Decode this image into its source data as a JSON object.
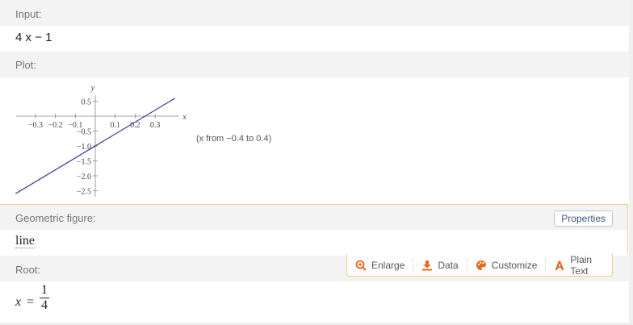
{
  "input": {
    "label": "Input:",
    "expression": "4 x − 1"
  },
  "plot": {
    "label": "Plot:",
    "range_note": "(x from −0.4 to 0.4)",
    "axis_x_label": "x",
    "axis_y_label": "y"
  },
  "geometric_figure": {
    "label": "Geometric figure:",
    "properties_button": "Properties",
    "value": "line"
  },
  "toolbar": {
    "enlarge": "Enlarge",
    "data": "Data",
    "customize": "Customize",
    "plain_text": "Plain Text"
  },
  "root": {
    "label": "Root:",
    "variable": "x",
    "operator": "=",
    "numerator": "1",
    "denominator": "4"
  },
  "colors": {
    "line": "#3f3f9f",
    "accent": "#f5c88f",
    "icon": "#e8671e"
  },
  "chart_data": {
    "type": "line",
    "function": "4x - 1",
    "x_range": [
      -0.4,
      0.4
    ],
    "series": [
      {
        "x": [
          -0.4,
          0.4
        ],
        "y": [
          -2.6,
          0.6
        ]
      }
    ],
    "xlabel": "x",
    "ylabel": "y",
    "x_ticks": [
      "−0.3",
      "−0.2",
      "−0.1",
      "0.1",
      "0.2",
      "0.3"
    ],
    "x_tick_values": [
      -0.3,
      -0.2,
      -0.1,
      0.1,
      0.2,
      0.3
    ],
    "y_ticks": [
      "0.5",
      "−0.5",
      "−1.0",
      "−1.5",
      "−2.0",
      "−2.5"
    ],
    "y_tick_values": [
      0.5,
      -0.5,
      -1.0,
      -1.5,
      -2.0,
      -2.5
    ]
  }
}
